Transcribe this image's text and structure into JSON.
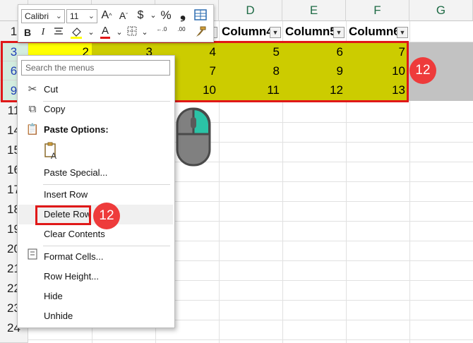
{
  "columns": [
    {
      "id": "col-a",
      "label": ""
    },
    {
      "id": "col-b",
      "label": ""
    },
    {
      "id": "col-c",
      "label": ""
    },
    {
      "id": "col-d",
      "label": "D"
    },
    {
      "id": "col-e",
      "label": "E"
    },
    {
      "id": "col-f",
      "label": "F"
    },
    {
      "id": "col-g",
      "label": "G"
    }
  ],
  "row_numbers": [
    "1",
    "3",
    "6",
    "9",
    "11",
    "14",
    "15",
    "16",
    "17",
    "18",
    "19",
    "20",
    "21",
    "22",
    "23",
    "24"
  ],
  "table_headers": [
    "Column4",
    "Column5",
    "Column6"
  ],
  "rows": [
    {
      "row": "3",
      "values": [
        "2",
        "3",
        "4",
        "5",
        "6",
        "7"
      ]
    },
    {
      "row": "6",
      "values": [
        "7",
        "8",
        "9",
        "10"
      ]
    },
    {
      "row": "9",
      "values": [
        "10",
        "11",
        "12",
        "13"
      ]
    }
  ],
  "badges": {
    "row_badge": "12",
    "menu_badge": "12"
  },
  "mini_toolbar": {
    "font_name": "Calibri",
    "font_size": "11",
    "grow_font": "A",
    "shrink_font": "A",
    "currency": "$",
    "percent": "%",
    "comma_style": "❟",
    "bold": "B",
    "italic": "I",
    "font_color_letter": "A",
    "decrease_decimal": "←.0",
    "increase_decimal": ".00"
  },
  "context_menu": {
    "search_placeholder": "Search the menus",
    "items": [
      {
        "label": "Cut",
        "icon": "scissors-icon"
      },
      {
        "label": "Copy",
        "icon": "copy-icon"
      },
      {
        "label": "Paste Options:",
        "icon": "paste-icon"
      },
      {
        "label": "Paste Special...",
        "icon": ""
      },
      {
        "label": "Insert Row",
        "icon": ""
      },
      {
        "label": "Delete Row",
        "icon": ""
      },
      {
        "label": "Clear Contents",
        "icon": ""
      },
      {
        "label": "Format Cells...",
        "icon": "format-cells-icon"
      },
      {
        "label": "Row Height...",
        "icon": ""
      },
      {
        "label": "Hide",
        "icon": ""
      },
      {
        "label": "Unhide",
        "icon": ""
      }
    ]
  },
  "colors": {
    "band": "#cccc00",
    "highlight_cell": "#ffff00",
    "selection_border": "#e01818",
    "badge": "#ee3b3b",
    "mouse_button": "#2bc3a6"
  }
}
